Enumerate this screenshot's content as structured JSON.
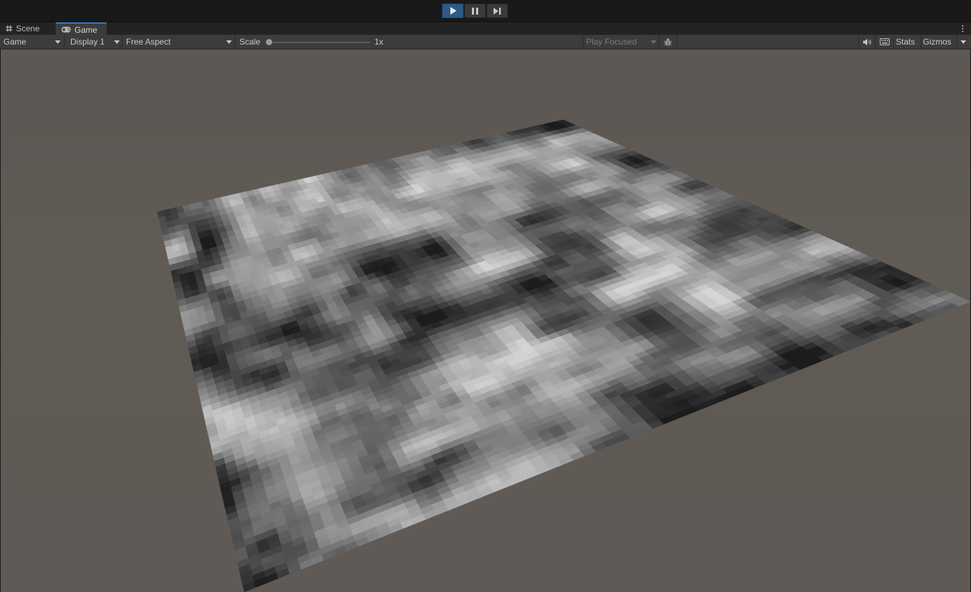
{
  "tabs": [
    {
      "label": "Scene",
      "icon": "hash-icon"
    },
    {
      "label": "Game",
      "icon": "gamepad-icon",
      "active": true
    }
  ],
  "play_controls": {
    "play_icon": "play-icon",
    "pause_icon": "pause-icon",
    "step_icon": "step-icon",
    "play_active": true
  },
  "toolbar": {
    "view_mode": "Game",
    "display": "Display 1",
    "aspect": "Free Aspect",
    "scale_label": "Scale",
    "scale_value": "1x",
    "scale_fraction": 0.0,
    "play_mode": "Play Focused",
    "stats_label": "Stats",
    "gizmos_label": "Gizmos",
    "icons": [
      "bug-icon",
      "speaker-icon",
      "keyboard-icon",
      "chevron-down-icon"
    ]
  },
  "viewport": {
    "background_color": "#5e5954",
    "content": "noise-terrain-plane"
  }
}
